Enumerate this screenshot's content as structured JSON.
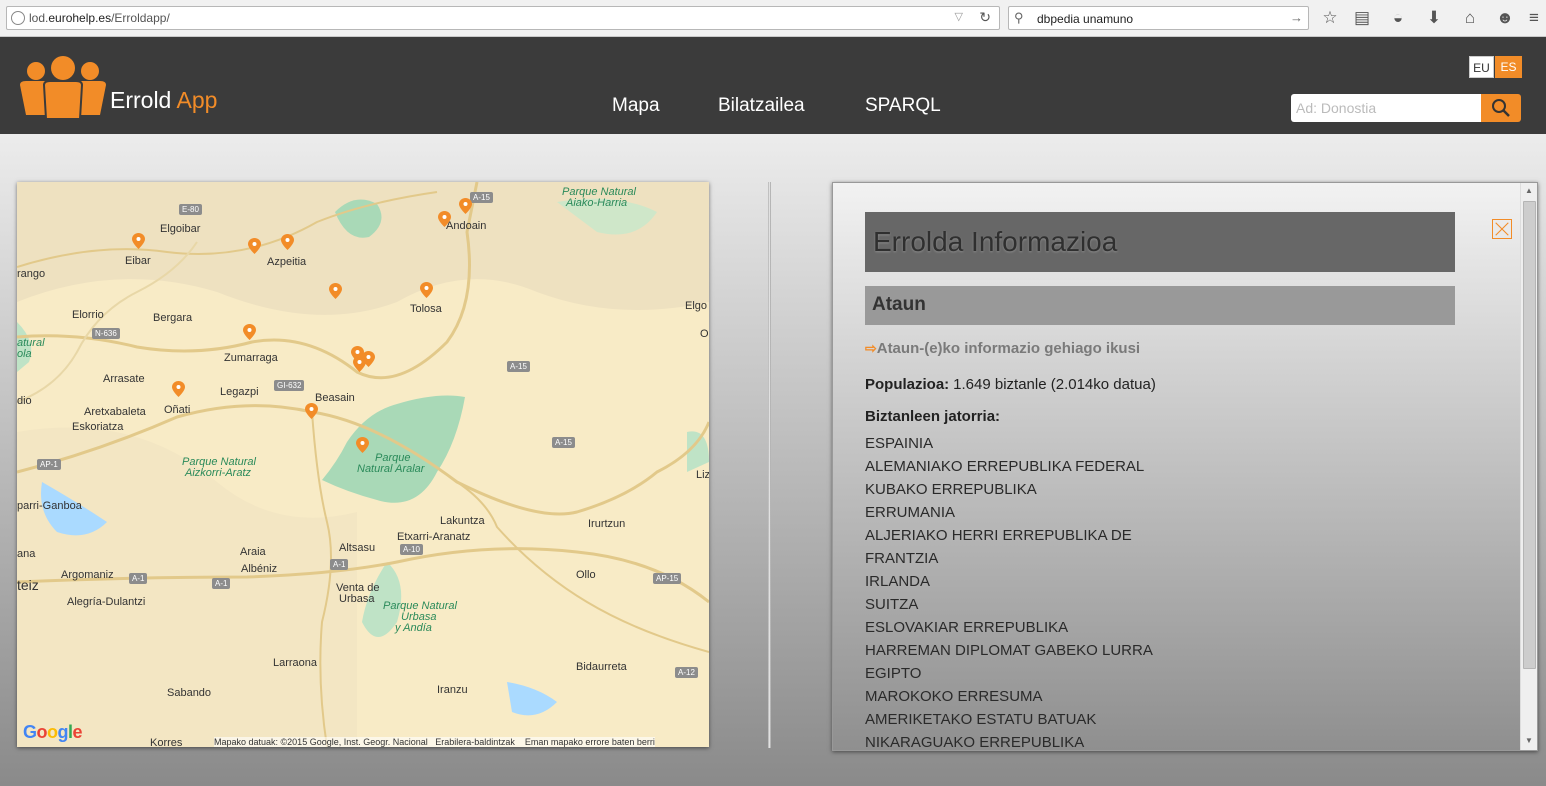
{
  "browser": {
    "url_prefix": "lod.",
    "url_domain": "eurohelp.es",
    "url_path": "/Erroldapp/",
    "search_text": "dbpedia unamuno",
    "icons": [
      "globe-icon",
      "dropdown-icon",
      "reload-icon",
      "search-icon",
      "star-icon",
      "reading-list-icon",
      "pocket-icon",
      "download-icon",
      "home-icon",
      "hello-icon",
      "menu-icon"
    ]
  },
  "header": {
    "brand_main": "Errold",
    "brand_accent": "App",
    "nav": [
      "Mapa",
      "Bilatzailea",
      "SPARQL"
    ],
    "lang_eu": "EU",
    "lang_es": "ES",
    "search_placeholder": "Ad: Donostia",
    "accent_color": "#f28c28"
  },
  "map": {
    "labels": [
      "Elgoibar",
      "Eibar",
      "Azpeitia",
      "Andoain",
      "rango",
      "Tolosa",
      "Elorrio",
      "Bergara",
      "Elgo",
      "Zumarraga",
      "atural",
      "ola",
      "Arrasate",
      "Legazpi",
      "Beasain",
      "dio",
      "Aretxabaleta",
      "Oñati",
      "Eskoriatza",
      "Lakuntza",
      "Irurtzun",
      "Araia",
      "Altsasu",
      "Etxarri-Aranatz",
      "Albéniz",
      "Argomaniz",
      "Ollo",
      "teiz",
      "Venta de",
      "Urbasa",
      "Alegría-Dulantzi",
      "Larraona",
      "Bidaurreta",
      "Sabando",
      "Iranzu",
      "Korres",
      "parri-Ganboa",
      "ana",
      "Liz",
      "O"
    ],
    "parks": [
      "Parque Natural",
      "Aiako-Harria",
      "Parque",
      "Natural Aralar",
      "Parque Natural",
      "Aizkorri-Aratz",
      "Parque Natural",
      "Urbasa",
      "y Andía"
    ],
    "roads": [
      "E-80",
      "A-15",
      "N-636",
      "GI-632",
      "A-15",
      "A-15",
      "AP-1",
      "A-10",
      "A-1",
      "A-1",
      "A-1",
      "AP-15",
      "A-12"
    ],
    "google": "Google",
    "attribution": "Mapako datuak: ©2015 Google, Inst. Geogr. Nacional",
    "terms": "Erabilera-baldintzak",
    "report": "Eman mapako errore baten berri",
    "marker_count": 16
  },
  "panel": {
    "title": "Errolda Informazioa",
    "place": "Ataun",
    "more_info": "Ataun-(e)ko informazio gehiago ikusi",
    "population_label": "Populazioa:",
    "population_value": "1.649 biztanle (2.014ko datua)",
    "origin_label": "Biztanleen jatorria:",
    "origins": [
      "ESPAINIA",
      "ALEMANIAKO ERREPUBLIKA FEDERAL",
      "KUBAKO ERREPUBLIKA",
      "ERRUMANIA",
      "ALJERIAKO HERRI ERREPUBLIKA DE",
      "FRANTZIA",
      "IRLANDA",
      "SUITZA",
      "ESLOVAKIAR ERREPUBLIKA",
      "HARREMAN DIPLOMAT GABEKO LURRA",
      "EGIPTO",
      "MAROKOKO ERRESUMA",
      "AMERIKETAKO ESTATU BATUAK",
      "NIKARAGUAKO ERREPUBLIKA"
    ]
  }
}
